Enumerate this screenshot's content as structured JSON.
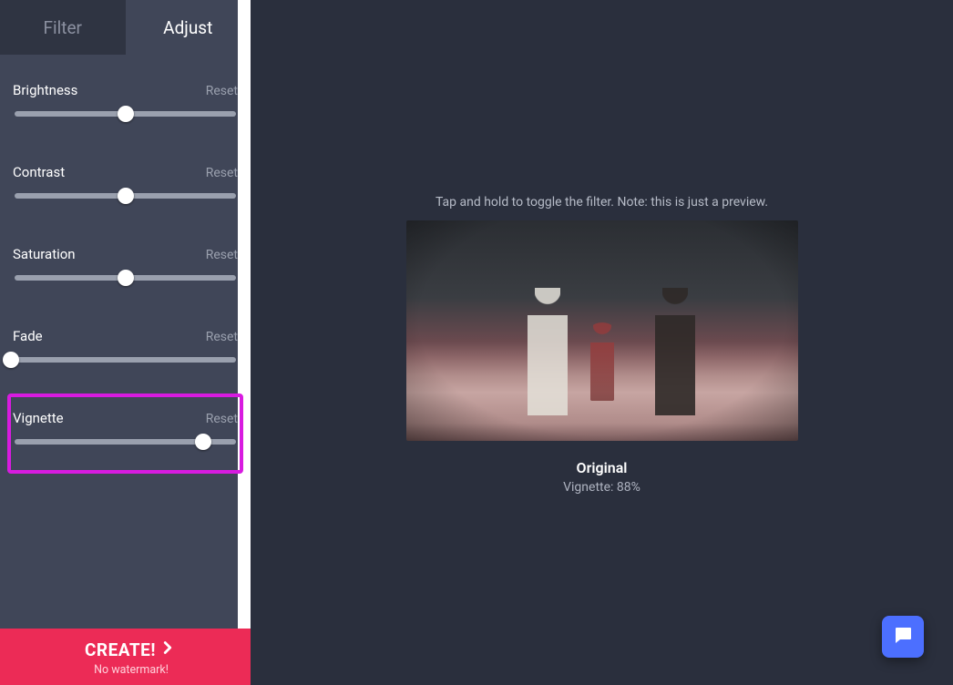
{
  "tabs": {
    "filter": "Filter",
    "adjust": "Adjust",
    "active": "adjust"
  },
  "reset_label": "Reset",
  "controls": [
    {
      "key": "brightness",
      "label": "Brightness",
      "value": 50,
      "highlighted": false
    },
    {
      "key": "contrast",
      "label": "Contrast",
      "value": 50,
      "highlighted": false
    },
    {
      "key": "saturation",
      "label": "Saturation",
      "value": 50,
      "highlighted": false
    },
    {
      "key": "fade",
      "label": "Fade",
      "value": 0,
      "highlighted": false
    },
    {
      "key": "vignette",
      "label": "Vignette",
      "value": 84,
      "highlighted": true
    }
  ],
  "create": {
    "label": "CREATE!",
    "subtext": "No watermark!"
  },
  "preview": {
    "hint": "Tap and hold to toggle the filter. Note: this is just a preview.",
    "title": "Original",
    "readout": "Vignette: 88%"
  },
  "icons": {
    "chevron_right": "chevron-right-icon",
    "chat": "chat-icon"
  },
  "colors": {
    "accent": "#ec2b56",
    "highlight": "#d81be0",
    "fab": "#4c6fff",
    "sidebar": "#404658",
    "surface": "#2a2f3d"
  }
}
